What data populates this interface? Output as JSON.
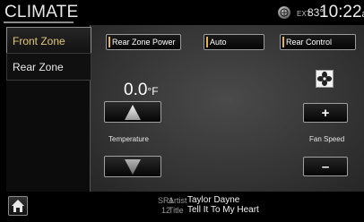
{
  "header": {
    "title": "CLIMATE",
    "ext_label": "EXT",
    "ext_temp": "83°",
    "clock": "10:22",
    "clock_suffix": "am"
  },
  "tabs": [
    {
      "label": "Front Zone",
      "active": true
    },
    {
      "label": "Rear Zone",
      "active": false
    }
  ],
  "controls": {
    "rear_zone_power": "Rear Zone Power",
    "auto": "Auto",
    "rear_control": "Rear Control"
  },
  "temperature": {
    "value": "0.0",
    "unit": "°F",
    "label": "Temperature"
  },
  "fan": {
    "label": "Fan Speed",
    "plus": "+",
    "minus": "–"
  },
  "now_playing": {
    "band": "SR1",
    "preset": "12",
    "artist_label": "Artist",
    "artist": "Taylor Dayne",
    "title_label": "Title",
    "title": "Tell It To My Heart"
  },
  "icons": {
    "home": "home-icon",
    "fan": "fan-icon",
    "sirius": "sirius-icon",
    "temp_up": "triangle-up-icon",
    "temp_down": "triangle-down-icon"
  },
  "colors": {
    "accent": "#e3c67a",
    "led": "#e6b24a"
  }
}
